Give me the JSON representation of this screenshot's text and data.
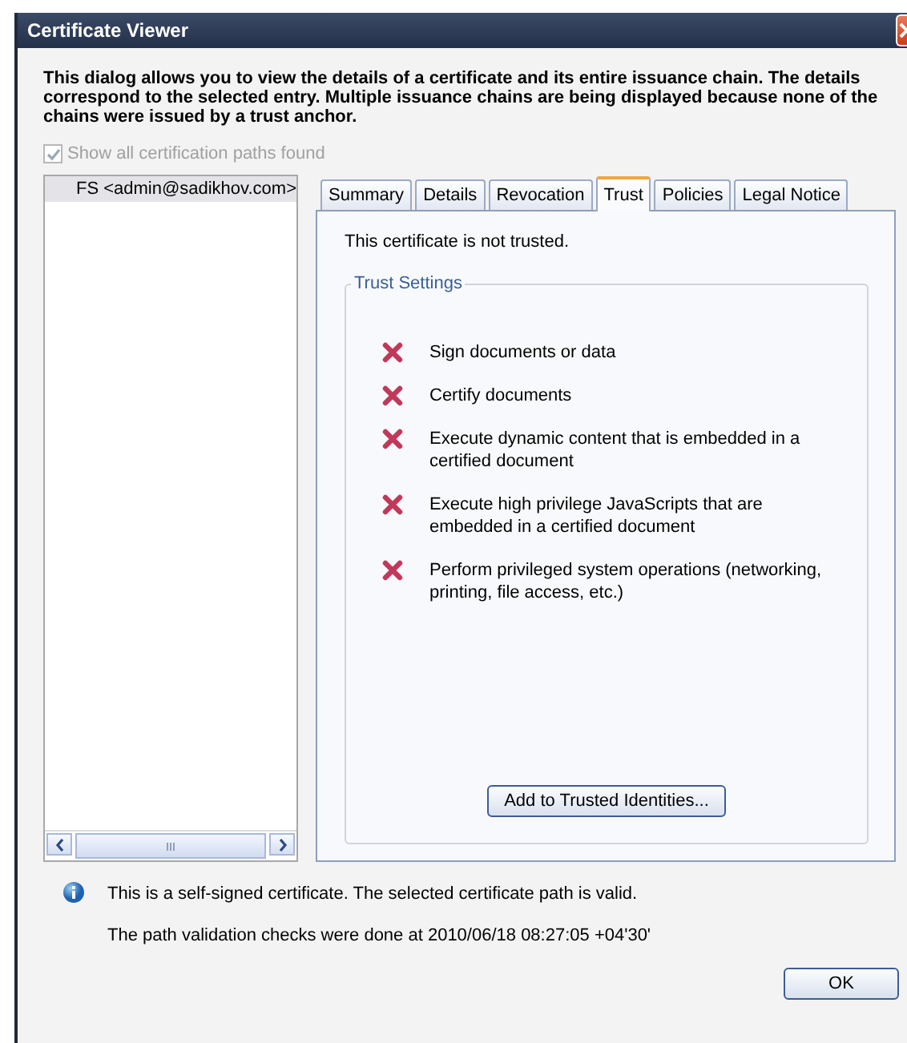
{
  "window": {
    "title": "Certificate Viewer"
  },
  "intro": "This dialog allows you to view the details of a certificate and its entire issuance chain. The details correspond to the selected entry. Multiple issuance chains are being displayed because none of the chains were issued by a trust anchor.",
  "show_all_paths": {
    "label": "Show all certification paths found",
    "checked": true,
    "disabled": true
  },
  "chain": [
    {
      "label": "FS <admin@sadikhov.com>",
      "selected": true
    }
  ],
  "tabs": [
    {
      "label": "Summary",
      "selected": false
    },
    {
      "label": "Details",
      "selected": false
    },
    {
      "label": "Revocation",
      "selected": false
    },
    {
      "label": "Trust",
      "selected": true
    },
    {
      "label": "Policies",
      "selected": false
    },
    {
      "label": "Legal Notice",
      "selected": false
    }
  ],
  "trust": {
    "status": "This certificate is not trusted.",
    "group_title": "Trust Settings",
    "permissions": [
      {
        "label": "Sign documents or data",
        "allowed": false
      },
      {
        "label": "Certify documents",
        "allowed": false
      },
      {
        "label": "Execute dynamic content that is embedded in a certified document",
        "allowed": false
      },
      {
        "label": "Execute high privilege JavaScripts that are embedded in a certified document",
        "allowed": false
      },
      {
        "label": "Perform privileged system operations (networking, printing, file access, etc.)",
        "allowed": false
      }
    ],
    "add_button": "Add to Trusted Identities..."
  },
  "messages": [
    "This is a self-signed certificate. The selected certificate path is valid.",
    "The path validation checks were done at 2010/06/18 08:27:05 +04'30'"
  ],
  "buttons": [
    "OK"
  ]
}
